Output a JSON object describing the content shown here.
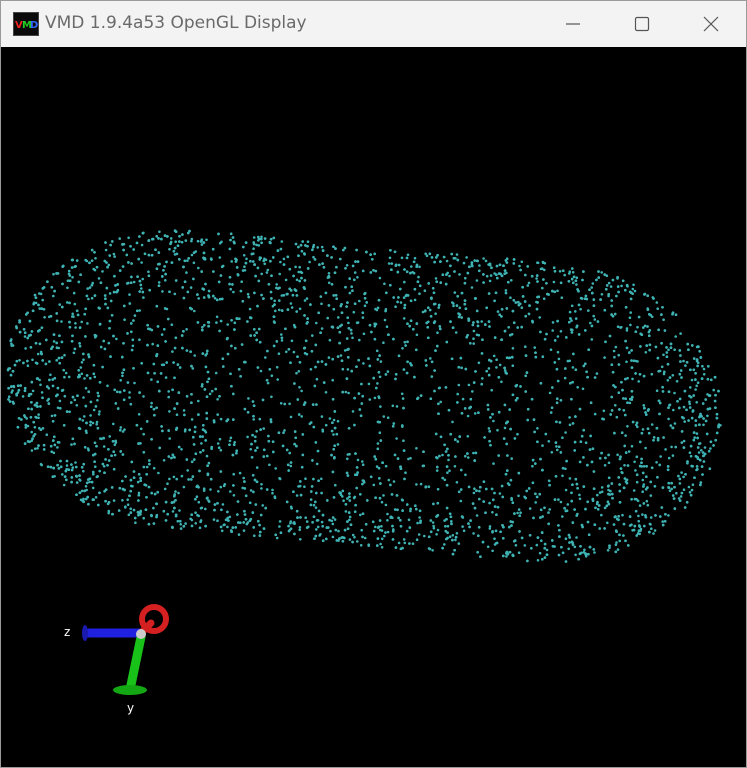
{
  "window": {
    "title": "VMD 1.9.4a53 OpenGL Display",
    "app_icon_text": "VMD",
    "controls": {
      "minimize": "minimize-icon",
      "maximize": "maximize-icon",
      "close": "close-icon"
    }
  },
  "scene": {
    "background": "#000000",
    "point_color": "#3fb3b3",
    "axes": {
      "z_label": "z",
      "y_label": "y",
      "x_color": "#d42020",
      "y_color": "#19c219",
      "z_color": "#2020e0"
    }
  }
}
